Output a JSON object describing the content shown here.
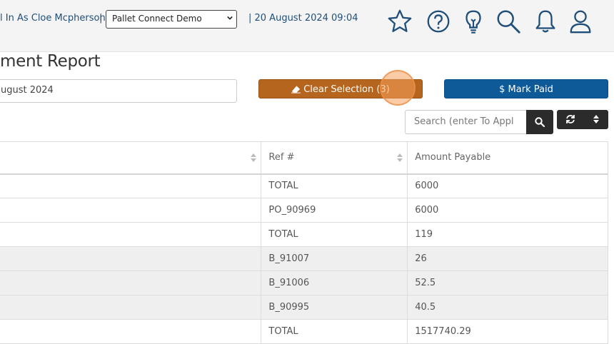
{
  "header": {
    "login_text": "l In As Cloe Mcpherson",
    "separator": "|",
    "company_selected": "Pallet Connect Demo",
    "datetime": "| 20 August 2024 09:04",
    "icons": [
      "star-icon",
      "help-icon",
      "lightbulb-icon",
      "search-icon",
      "bell-icon",
      "user-icon"
    ]
  },
  "page": {
    "title": "ment Report",
    "date_value": "ugust 2024"
  },
  "actions": {
    "clear_label": "Clear Selection (3)",
    "mark_paid_label": "$ Mark Paid"
  },
  "search": {
    "placeholder": "Search (enter To Appl"
  },
  "table": {
    "columns": [
      "",
      "Ref #",
      "Amount Payable"
    ],
    "rows": [
      {
        "ref": "TOTAL",
        "amount": "6000"
      },
      {
        "ref": "PO_90969",
        "amount": "6000"
      },
      {
        "ref": "TOTAL",
        "amount": "119"
      },
      {
        "ref": "B_91007",
        "amount": "26"
      },
      {
        "ref": "B_91006",
        "amount": "52.5"
      },
      {
        "ref": "B_90995",
        "amount": "40.5"
      },
      {
        "ref": "TOTAL",
        "amount": "1517740.29"
      }
    ]
  },
  "colors": {
    "clear_button": "#b5651d",
    "mark_paid_button": "#0e5a99",
    "icon_stroke": "#1f4e79",
    "dark_button": "#2b2b2b"
  }
}
